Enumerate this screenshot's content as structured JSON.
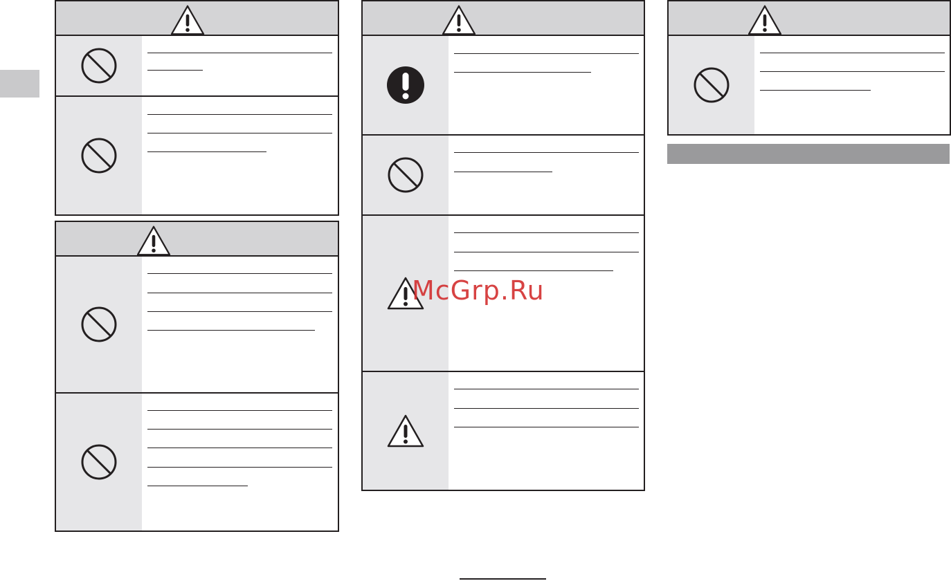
{
  "watermark": "McGrp.Ru",
  "colors": {
    "header_bg": "#d4d4d6",
    "icon_col_bg": "#e6e6e8",
    "side_tab": "#c9c9cb",
    "band": "#9a9a9c",
    "ink": "#231f20",
    "watermark": "#d32f2f"
  },
  "columns": [
    {
      "boxes": [
        {
          "header_icon": "warning-triangle-icon",
          "rows": [
            {
              "icon": "prohibition-icon"
            },
            {
              "icon": "prohibition-icon"
            }
          ]
        },
        {
          "header_icon": "warning-triangle-icon",
          "rows": [
            {
              "icon": "prohibition-icon"
            },
            {
              "icon": "prohibition-icon"
            }
          ]
        }
      ]
    },
    {
      "boxes": [
        {
          "header_icon": "warning-triangle-icon",
          "rows": [
            {
              "icon": "mandatory-exclamation-icon"
            },
            {
              "icon": "prohibition-icon"
            },
            {
              "icon": "warning-triangle-icon"
            },
            {
              "icon": "warning-triangle-icon"
            }
          ]
        }
      ]
    },
    {
      "boxes": [
        {
          "header_icon": "warning-triangle-icon",
          "rows": [
            {
              "icon": "prohibition-icon"
            }
          ]
        }
      ]
    }
  ]
}
